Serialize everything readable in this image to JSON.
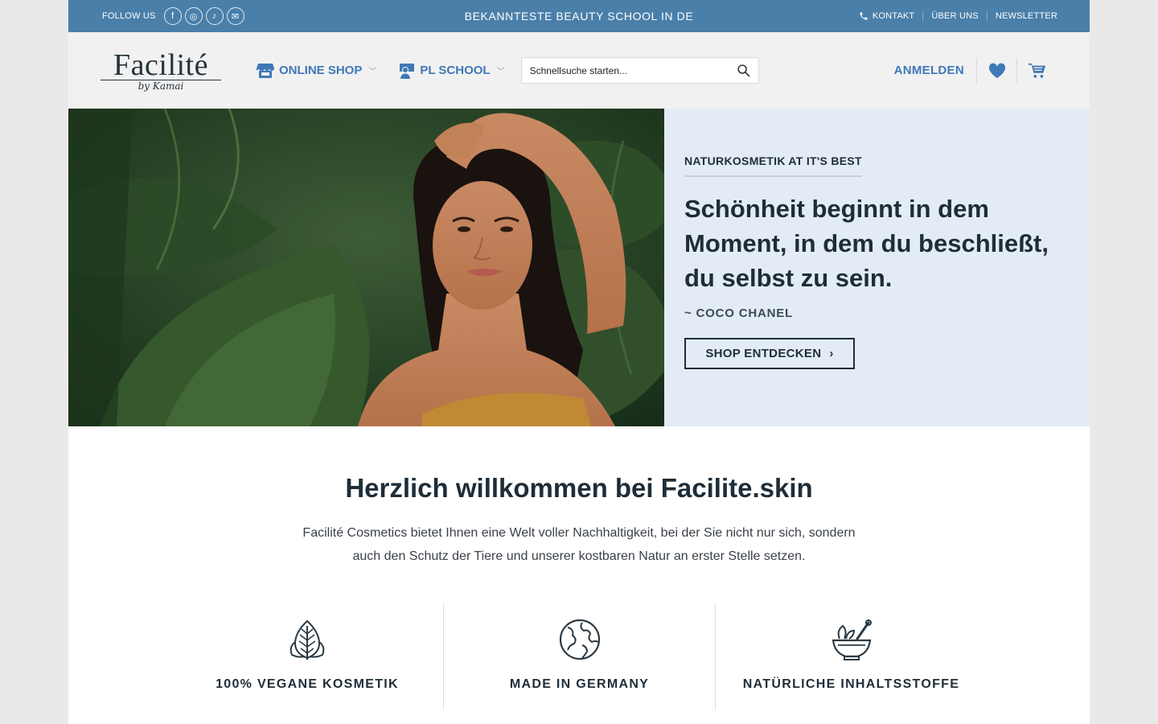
{
  "topbar": {
    "follow_label": "FOLLOW US",
    "social": [
      {
        "icon": "facebook-icon",
        "glyph": "f"
      },
      {
        "icon": "instagram-icon",
        "glyph": "◎"
      },
      {
        "icon": "tiktok-icon",
        "glyph": "♪"
      },
      {
        "icon": "mail-icon",
        "glyph": "✉"
      }
    ],
    "promo": "BEKANNTESTE BEAUTY SCHOOL IN DE",
    "links": {
      "kontakt": "KONTAKT",
      "ueber_uns": "ÜBER UNS",
      "newsletter": "NEWSLETTER"
    }
  },
  "header": {
    "logo_main": "Facilité",
    "logo_sub": "by Kamai",
    "nav": {
      "online_shop": "ONLINE SHOP",
      "pl_school": "PL SCHOOL"
    },
    "search_placeholder": "Schnellsuche starten...",
    "login": "ANMELDEN"
  },
  "hero": {
    "eyebrow": "NATURKOSMETIK AT IT'S BEST",
    "quote": "Schönheit beginnt in dem Moment, in dem du beschließt, du selbst zu sein.",
    "author": "~ COCO CHANEL",
    "cta": "SHOP ENTDECKEN"
  },
  "welcome": {
    "title": "Herzlich willkommen bei Facilite.skin",
    "text": "Facilité Cosmetics bietet Ihnen eine Welt voller Nachhaltigkeit, bei der Sie nicht nur sich, sondern auch den Schutz der Tiere und unserer kostbaren Natur an erster Stelle setzen."
  },
  "features": [
    {
      "icon": "leaf-icon",
      "label": "100% VEGANE KOSMETIK"
    },
    {
      "icon": "globe-icon",
      "label": "MADE IN GERMANY"
    },
    {
      "icon": "mortar-pestle-icon",
      "label": "NATÜRLICHE INHALTSSTOFFE"
    }
  ],
  "colors": {
    "brand_blue": "#3f78b6",
    "topbar": "#4a7fa9",
    "hero_panel": "#e3ecf5",
    "dark_text": "#1e2d38"
  }
}
